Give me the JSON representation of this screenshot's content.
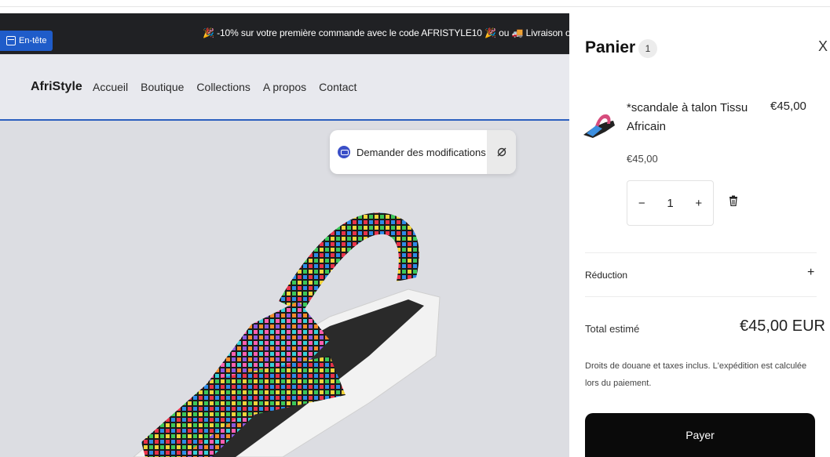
{
  "announcement": {
    "badge": "En-tête",
    "message": "🎉 -10% sur votre première commande avec le code AFRISTYLE10 🎉 ou 🚚 Livraison offerte"
  },
  "nav": {
    "brand": "AfriStyle",
    "links": [
      "Accueil",
      "Boutique",
      "Collections",
      "A propos",
      "Contact"
    ]
  },
  "editor": {
    "ask_label": "Demander des modifications"
  },
  "cart": {
    "title": "Panier",
    "count": "1",
    "close": "X",
    "item": {
      "name": "*scandale à talon Tissu Africain",
      "price_right": "€45,00",
      "price": "€45,00",
      "qty_minus": "−",
      "quantity": "1",
      "qty_plus": "+"
    },
    "reduction_label": "Réduction",
    "reduction_plus": "+",
    "total_label": "Total estimé",
    "total_value": "€45,00 EUR",
    "taxes_note": "Droits de douane et taxes inclus. L'expédition est calculée lors du paiement.",
    "pay_label": "Payer"
  }
}
